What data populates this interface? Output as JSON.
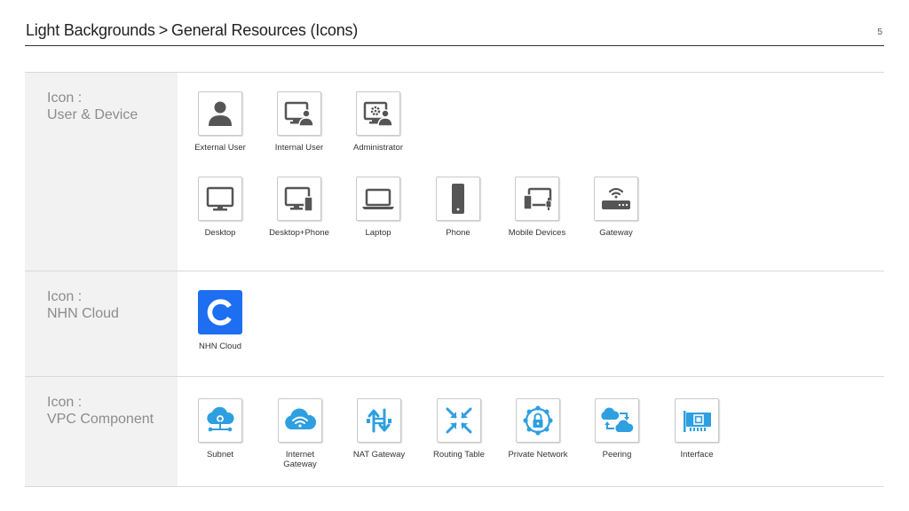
{
  "header": {
    "title_part1": "Light Backgrounds",
    "separator": ">",
    "title_part2": "General Resources (Icons)",
    "page_number": "5"
  },
  "colors": {
    "gray_icon": "#555555",
    "blue_icon": "#2e9fe0",
    "nhn_blue": "#1d6ef0"
  },
  "sections": [
    {
      "label_line1": "Icon :",
      "label_line2": "User & Device",
      "items": [
        {
          "label": "External User",
          "icon": "external-user-icon"
        },
        {
          "label": "Internal User",
          "icon": "internal-user-icon"
        },
        {
          "label": "Administrator",
          "icon": "administrator-icon"
        },
        {
          "label": "Desktop",
          "icon": "desktop-icon"
        },
        {
          "label": "Desktop+Phone",
          "icon": "desktop-phone-icon"
        },
        {
          "label": "Laptop",
          "icon": "laptop-icon"
        },
        {
          "label": "Phone",
          "icon": "phone-icon"
        },
        {
          "label": "Mobile Devices",
          "icon": "mobile-devices-icon"
        },
        {
          "label": "Gateway",
          "icon": "gateway-icon"
        }
      ]
    },
    {
      "label_line1": "Icon :",
      "label_line2": "NHN Cloud",
      "items": [
        {
          "label": "NHN Cloud",
          "icon": "nhn-cloud-logo-icon"
        }
      ]
    },
    {
      "label_line1": "Icon :",
      "label_line2": "VPC Component",
      "items": [
        {
          "label": "Subnet",
          "icon": "subnet-icon"
        },
        {
          "label": "Internet\nGateway",
          "icon": "internet-gateway-icon"
        },
        {
          "label": "NAT Gateway",
          "icon": "nat-gateway-icon"
        },
        {
          "label": "Routing Table",
          "icon": "routing-table-icon"
        },
        {
          "label": "Private Network",
          "icon": "private-network-icon"
        },
        {
          "label": "Peering",
          "icon": "peering-icon"
        },
        {
          "label": "Interface",
          "icon": "interface-icon"
        }
      ]
    }
  ]
}
